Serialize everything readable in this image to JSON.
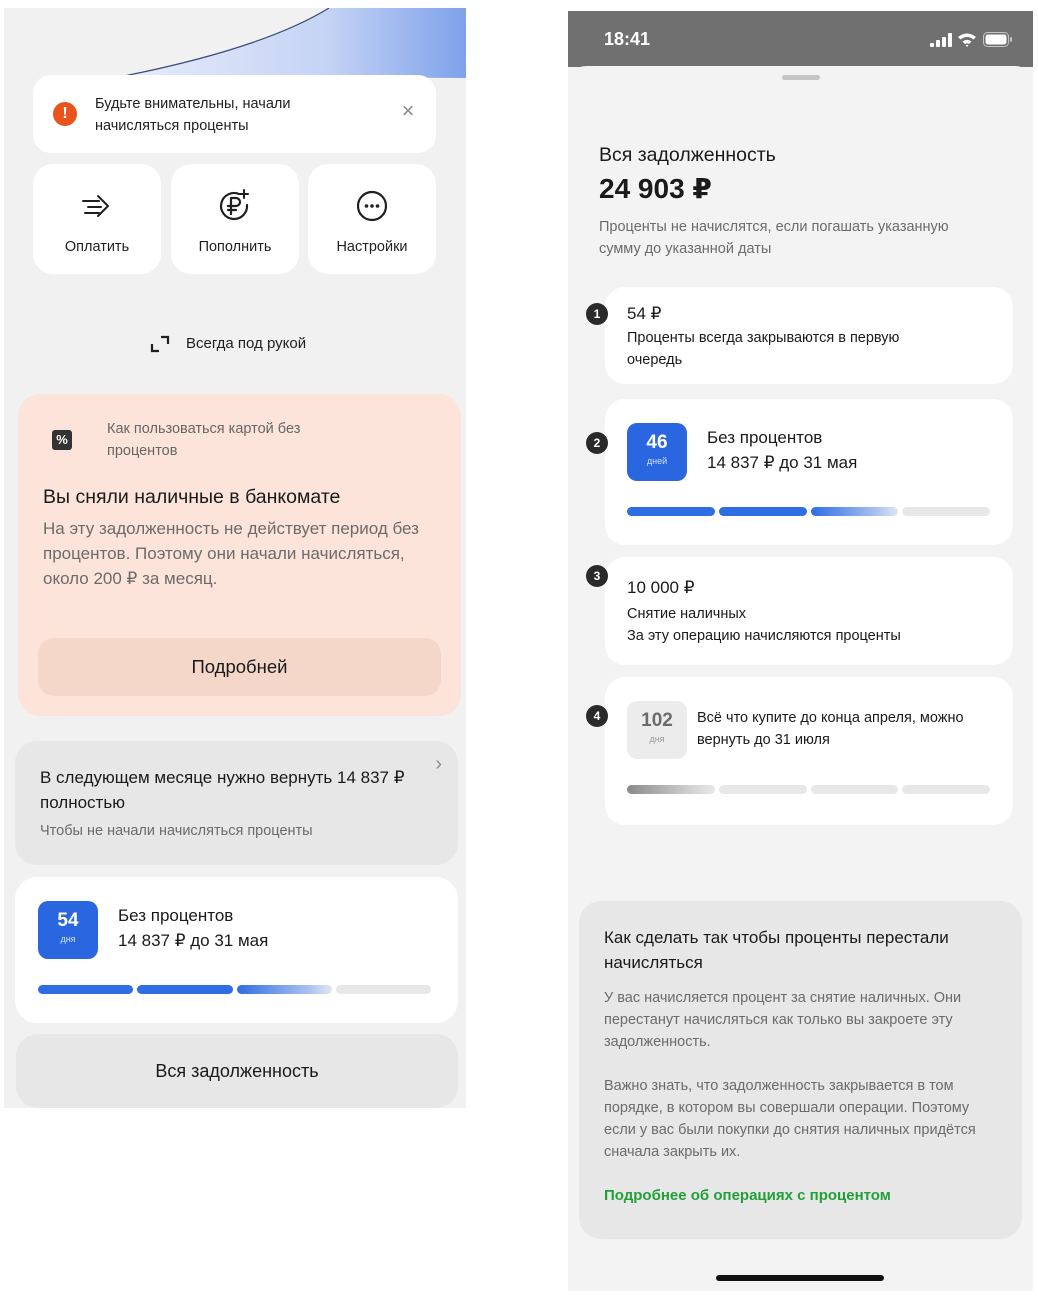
{
  "left": {
    "alert": {
      "text": "Будьте внимательны, начали начисляться проценты",
      "close": "×"
    },
    "actions": [
      {
        "label": "Оплатить",
        "icon": "arrow-right-icon"
      },
      {
        "label": "Пополнить",
        "icon": "ruble-plus-icon"
      },
      {
        "label": "Настройки",
        "icon": "more-dots-icon"
      }
    ],
    "always_handy": "Всегда под рукой",
    "cash_card": {
      "hint": "Как пользоваться картой без процентов",
      "title": "Вы сняли наличные в банкомате",
      "body": "На эту задолженность не действует период без процентов. Поэтому они начали начисляться, около 200 ₽ за месяц.",
      "more_button": "Подробней"
    },
    "next_month": {
      "title": "В следующем месяце нужно вернуть 14 837 ₽ полностью",
      "subtitle": "Чтобы не начали начисляться проценты",
      "chevron": "›"
    },
    "no_interest": {
      "days": "54",
      "days_label": "дня",
      "title": "Без процентов",
      "amount": "14 837 ₽ до 31 мая",
      "progress": [
        1,
        1,
        0.75,
        0
      ]
    },
    "all_debt_button": "Вся задолженность"
  },
  "right": {
    "status": {
      "time": "18:41"
    },
    "header": "Вся задолженность",
    "total": "24 903 ₽",
    "description": "Проценты не начислятся, если погашать указанную сумму до указанной даты",
    "steps": [
      {
        "num": "1",
        "amount": "54 ₽",
        "text": "Проценты всегда закрываются в первую очередь"
      },
      {
        "num": "2",
        "days": "46",
        "days_label": "дней",
        "title": "Без процентов",
        "amount": "14 837 ₽ до 31 мая",
        "progress": [
          1,
          1,
          0.75,
          0
        ]
      },
      {
        "num": "3",
        "amount": "10 000 ₽",
        "line1": "Снятие наличных",
        "line2": "За эту операцию начисляются проценты"
      },
      {
        "num": "4",
        "days": "102",
        "days_label": "дня",
        "text": "Всё что купите до конца апреля, можно вернуть до 31 июля",
        "progress": [
          0.8,
          0,
          0,
          0
        ]
      }
    ],
    "howto": {
      "title": "Как сделать так чтобы проценты перестали начисляться",
      "p1": "У вас начисляется процент за снятие наличных. Они перестанут начисляться как только вы закроете эту задолженность.",
      "p2": "Важно знать, что задолженность закрывается в том порядке, в котором вы совершали операции. Поэтому если у вас были покупки до снятия наличных придётся сначала закрыть их.",
      "link": "Подробнее об операциях с процентом"
    }
  },
  "colors": {
    "accent_blue": "#2f6de3",
    "warning_orange": "#e8541c",
    "peach": "#fde4da",
    "link_green": "#21a038"
  }
}
